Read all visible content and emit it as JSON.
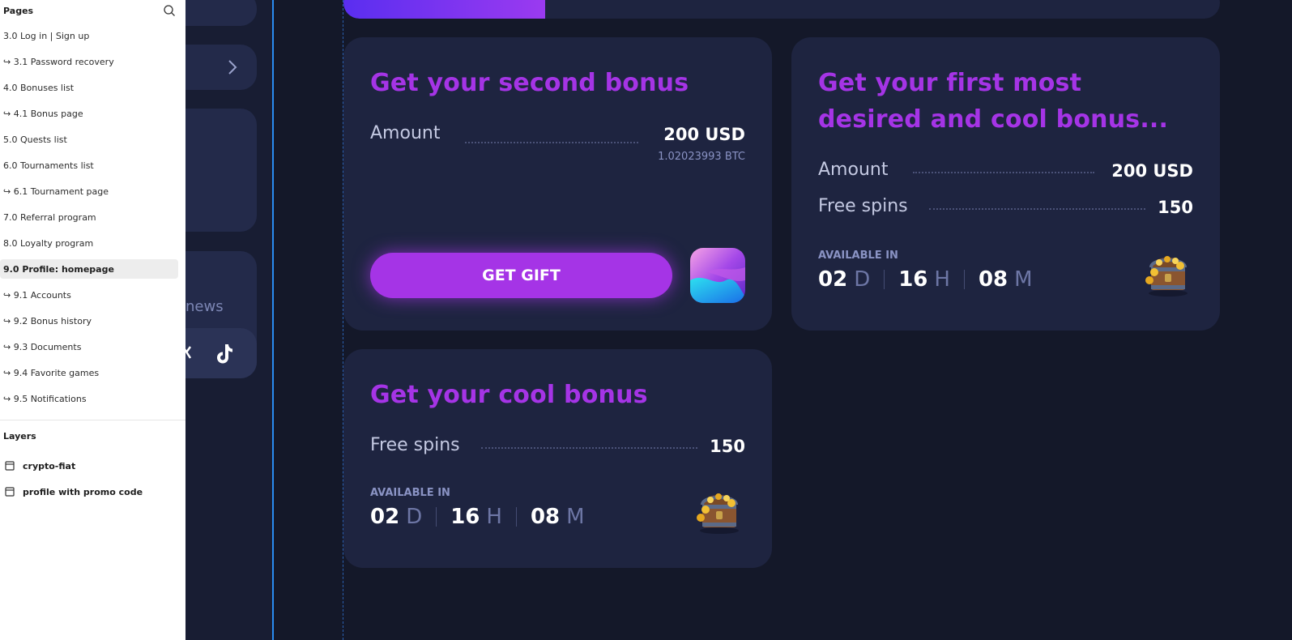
{
  "panel": {
    "pages_title": "Pages",
    "pages": [
      "3.0 Log in | Sign up",
      "↪ 3.1 Password recovery",
      "4.0 Bonuses list",
      "↪ 4.1 Bonus page",
      "5.0 Quests list",
      "6.0 Tournaments list",
      "↪ 6.1 Tournament page",
      "7.0 Referral program",
      "8.0 Loyalty program",
      "9.0 Profile: homepage",
      "↪ 9.1 Accounts",
      "↪ 9.2 Bonus history",
      "↪ 9.3 Documents",
      "↪ 9.4 Favorite games",
      "↪ 9.5 Notifications"
    ],
    "selected_page": "9.0 Profile: homepage",
    "layers_title": "Layers",
    "layers": [
      "crypto-fiat",
      "profile with promo code"
    ]
  },
  "sidebar": {
    "news_fragment": "news"
  },
  "progress": {
    "fraction": 0.23
  },
  "cards": {
    "second": {
      "title": "Get your second bonus",
      "amount_label": "Amount",
      "amount_value": "200 USD",
      "amount_sub": "1.02023993 BTC",
      "button": "GET GIFT"
    },
    "first": {
      "title_line1": "Get your first most",
      "title_line2": "desired and cool bonus...",
      "amount_label": "Amount",
      "amount_value": "200 USD",
      "spins_label": "Free spins",
      "spins_value": "150",
      "available_label": "AVAILABLE IN",
      "timer": {
        "days": "02",
        "days_unit": "D",
        "hours": "16",
        "hours_unit": "H",
        "minutes": "08",
        "minutes_unit": "M"
      }
    },
    "cool": {
      "title": "Get your cool bonus",
      "spins_label": "Free spins",
      "spins_value": "150",
      "available_label": "AVAILABLE IN",
      "timer": {
        "days": "02",
        "days_unit": "D",
        "hours": "16",
        "hours_unit": "H",
        "minutes": "08",
        "minutes_unit": "M"
      }
    }
  },
  "colors": {
    "accent": "#a534e6",
    "background": "#141829",
    "card": "#1e2440",
    "selection_line": "#2a8cf0"
  },
  "icons": [
    "search-icon",
    "chevron-right-icon",
    "tiktok-icon",
    "app-icon",
    "treasure-chest-icon",
    "page-frame-icon"
  ]
}
